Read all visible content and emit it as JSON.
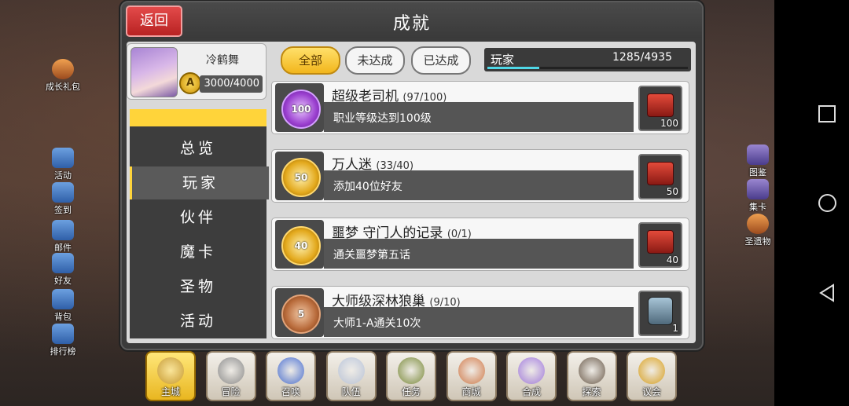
{
  "window": {
    "title": "成就",
    "back_label": "返回"
  },
  "side_left": [
    {
      "label": "成长礼包",
      "name": "growth-gift",
      "icon": "gift-icon",
      "color": "orange"
    },
    {
      "label": "活动",
      "name": "events",
      "icon": "event-icon",
      "color": "blue"
    },
    {
      "label": "签到",
      "name": "checkin",
      "icon": "checkin-icon",
      "color": "blue"
    },
    {
      "label": "邮件",
      "name": "mail",
      "icon": "mail-icon",
      "color": "blue"
    },
    {
      "label": "好友",
      "name": "friends",
      "icon": "friends-icon",
      "color": "blue"
    },
    {
      "label": "背包",
      "name": "backpack",
      "icon": "backpack-icon",
      "color": "blue"
    },
    {
      "label": "排行榜",
      "name": "ranking",
      "icon": "ranking-icon",
      "color": "blue"
    }
  ],
  "side_right": [
    {
      "label": "图鉴",
      "name": "codex",
      "icon": "book-icon",
      "color": "purple"
    },
    {
      "label": "集卡",
      "name": "card-collect",
      "icon": "card-icon",
      "color": "purple"
    },
    {
      "label": "圣遗物",
      "name": "relic",
      "icon": "relic-icon",
      "color": "orange"
    }
  ],
  "profile": {
    "name": "冷鹤舞",
    "rank": "A",
    "exp": "3000/4000"
  },
  "menu": [
    {
      "label": "总览",
      "active": false
    },
    {
      "label": "玩家",
      "active": true
    },
    {
      "label": "伙伴",
      "active": false
    },
    {
      "label": "魔卡",
      "active": false
    },
    {
      "label": "圣物",
      "active": false
    },
    {
      "label": "活动",
      "active": false
    }
  ],
  "filters": [
    {
      "label": "全部",
      "active": true
    },
    {
      "label": "未达成",
      "active": false
    },
    {
      "label": "已达成",
      "active": false
    }
  ],
  "category_progress": {
    "label": "玩家",
    "value": "1285/4935",
    "fraction": 0.26
  },
  "achievements": [
    {
      "title": "超级老司机",
      "count": "(97/100)",
      "desc": "职业等级达到100级",
      "medal": "100",
      "medal_color": "purple",
      "reward": "chest",
      "reward_qty": "100"
    },
    {
      "title": "万人迷",
      "count": "(33/40)",
      "desc": "添加40位好友",
      "medal": "50",
      "medal_color": "gold",
      "reward": "chest",
      "reward_qty": "50"
    },
    {
      "title": "噩梦 守门人的记录",
      "count": "(0/1)",
      "desc": "通关噩梦第五话",
      "medal": "40",
      "medal_color": "gold",
      "reward": "chest",
      "reward_qty": "40"
    },
    {
      "title": "大师级深林狼巢",
      "count": "(9/10)",
      "desc": "大师1-A通关10次",
      "medal": "5",
      "medal_color": "bronze",
      "reward": "jar",
      "reward_qty": "1"
    }
  ],
  "bottom_nav": [
    {
      "label": "主城",
      "name": "main-city",
      "active": true,
      "color": "#c79a32"
    },
    {
      "label": "冒险",
      "name": "adventure",
      "active": false,
      "color": "#8a8a8a"
    },
    {
      "label": "召唤",
      "name": "summon",
      "active": false,
      "color": "#4a6fd0"
    },
    {
      "label": "队伍",
      "name": "team",
      "active": false,
      "color": "#b8c3d8"
    },
    {
      "label": "任务",
      "name": "quest",
      "active": false,
      "color": "#7a8a3a"
    },
    {
      "label": "商城",
      "name": "shop",
      "active": false,
      "color": "#d07a4a"
    },
    {
      "label": "合成",
      "name": "synthesis",
      "active": false,
      "color": "#a07adc"
    },
    {
      "label": "探索",
      "name": "explore",
      "active": false,
      "color": "#6a5a4a"
    },
    {
      "label": "议会",
      "name": "council",
      "active": false,
      "color": "#d8a020"
    }
  ]
}
